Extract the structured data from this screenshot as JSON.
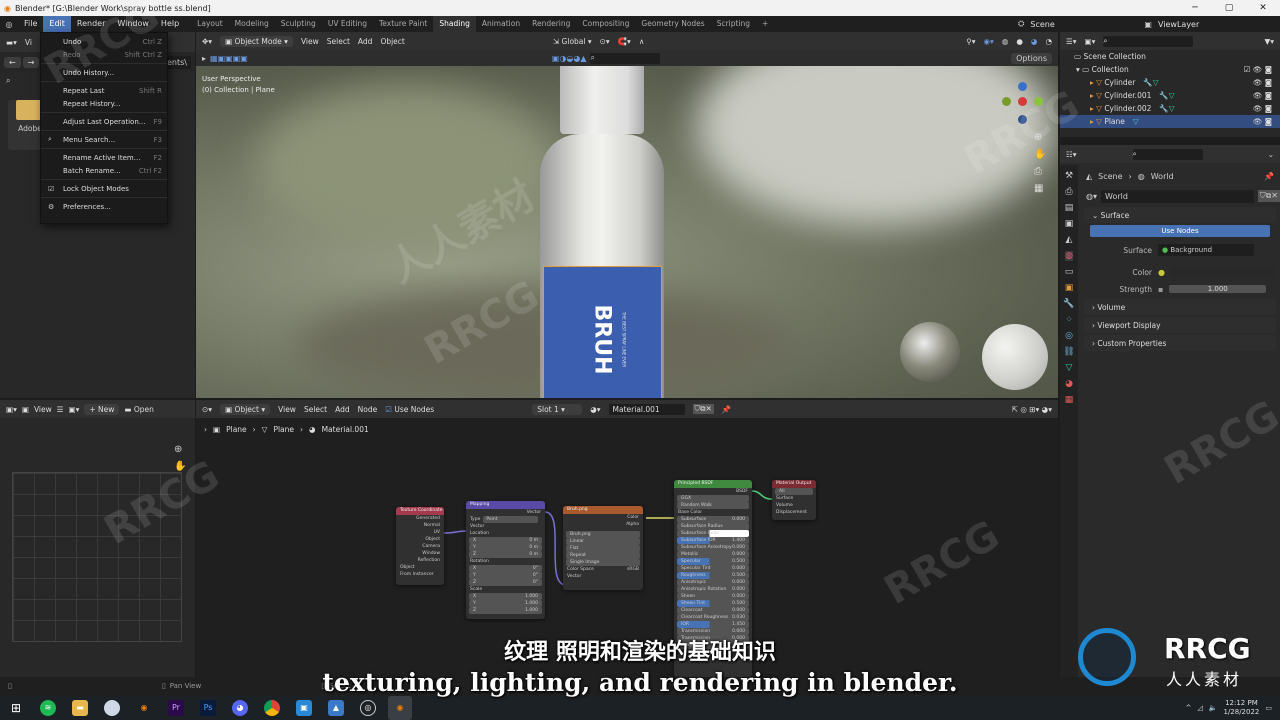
{
  "window": {
    "title": "Blender* [G:\\Blender Work\\spray bottle ss.blend]",
    "controls": [
      "─",
      "▢",
      "✕"
    ]
  },
  "menubar": {
    "items": [
      "File",
      "Edit",
      "Render",
      "Window",
      "Help"
    ],
    "workspaces": [
      "Layout",
      "Modeling",
      "Sculpting",
      "UV Editing",
      "Texture Paint",
      "Shading",
      "Animation",
      "Rendering",
      "Compositing",
      "Geometry Nodes",
      "Scripting",
      "+"
    ],
    "active_workspace": "Shading",
    "scene": "Scene",
    "view_layer": "ViewLayer"
  },
  "edit_menu": {
    "items": [
      {
        "label": "Undo",
        "shortcut": "Ctrl Z"
      },
      {
        "label": "Redo",
        "shortcut": "Shift Ctrl Z",
        "disabled": true
      },
      {
        "label": "Undo History..."
      },
      {
        "label": "Repeat Last",
        "shortcut": "Shift R"
      },
      {
        "label": "Repeat History..."
      },
      {
        "label": "Adjust Last Operation...",
        "shortcut": "F9"
      },
      {
        "label": "Menu Search...",
        "shortcut": "F3"
      },
      {
        "label": "Rename Active Item...",
        "shortcut": "F2"
      },
      {
        "label": "Batch Rename...",
        "shortcut": "Ctrl F2"
      },
      {
        "label": "Lock Object Modes",
        "checked": true
      },
      {
        "label": "Preferences..."
      }
    ]
  },
  "file_browser": {
    "view_label": "Vi",
    "path_fragment": "ents\\",
    "folder": "Adobe"
  },
  "viewport": {
    "mode": "Object Mode",
    "menus": [
      "View",
      "Select",
      "Add",
      "Object"
    ],
    "orientation": "Global",
    "options": "Options",
    "overlay_line1": "User Perspective",
    "overlay_line2": "(0) Collection | Plane",
    "label_text": "BRUH",
    "label_sub": "THE BEST SPRAY LINE EVER"
  },
  "outliner": {
    "root": "Scene Collection",
    "collection": "Collection",
    "items": [
      {
        "name": "Cylinder",
        "selected": false
      },
      {
        "name": "Cylinder.001",
        "selected": false
      },
      {
        "name": "Cylinder.002",
        "selected": false
      },
      {
        "name": "Plane",
        "selected": true
      }
    ]
  },
  "properties": {
    "breadcrumb": [
      "Scene",
      "World"
    ],
    "world_name": "World",
    "surface_section": "Surface",
    "use_nodes": "Use Nodes",
    "surface_label": "Surface",
    "surface_value": "Background",
    "color_label": "Color",
    "strength_label": "Strength",
    "strength_value": "1.000",
    "sections": [
      "Volume",
      "Viewport Display",
      "Custom Properties"
    ]
  },
  "image_editor": {
    "view": "View",
    "new": "New",
    "open": "Open"
  },
  "node_editor": {
    "mode": "Object",
    "menus": [
      "View",
      "Select",
      "Add",
      "Node"
    ],
    "use_nodes": "Use Nodes",
    "slot": "Slot 1",
    "material": "Material.001",
    "breadcrumb": [
      "Plane",
      "Plane",
      "Material.001"
    ],
    "nodes": {
      "texcoord": {
        "title": "Texture Coordinate",
        "outputs": [
          "Generated",
          "Normal",
          "UV",
          "Object",
          "Camera",
          "Window",
          "Reflection"
        ],
        "object": "Object",
        "instancer": "From Instancer"
      },
      "mapping": {
        "title": "Mapping",
        "output": "Vector",
        "type_label": "Type",
        "type": "Point",
        "vector": "Vector",
        "location": "Location",
        "loc": [
          "0 m",
          "0 m",
          "0 m"
        ],
        "rotation": "Rotation",
        "rot": [
          "0°",
          "0°",
          "0°"
        ],
        "scale": "Scale",
        "scl": [
          "1.000",
          "1.000",
          "1.000"
        ],
        "axes": [
          "X",
          "Y",
          "Z"
        ]
      },
      "image": {
        "title": "Bruh.png",
        "outputs": [
          "Color",
          "Alpha"
        ],
        "image": "Bruh.png",
        "interp": "Linear",
        "proj": "Flat",
        "ext": "Repeat",
        "source": "Single Image",
        "cs_label": "Color Space",
        "cs": "sRGB",
        "input": "Vector"
      },
      "bsdf": {
        "title": "Principled BSDF",
        "output": "BSDF",
        "dist": "GGX",
        "sss": "Random Walk",
        "rows": [
          [
            "Base Color",
            ""
          ],
          [
            "Subsurface",
            "0.000"
          ],
          [
            "Subsurface Radius",
            ""
          ],
          [
            "Subsurface Color",
            ""
          ],
          [
            "Subsurface IOR",
            "1.400"
          ],
          [
            "Subsurface Anisotropy",
            "0.000"
          ],
          [
            "Metallic",
            "0.000"
          ],
          [
            "Specular",
            "0.500"
          ],
          [
            "Specular Tint",
            "0.000"
          ],
          [
            "Roughness",
            "0.500"
          ],
          [
            "Anisotropic",
            "0.000"
          ],
          [
            "Anisotropic Rotation",
            "0.000"
          ],
          [
            "Sheen",
            "0.000"
          ],
          [
            "Sheen Tint",
            "0.500"
          ],
          [
            "Clearcoat",
            "0.000"
          ],
          [
            "Clearcoat Roughness",
            "0.030"
          ],
          [
            "IOR",
            "1.450"
          ],
          [
            "Transmission",
            "0.000"
          ],
          [
            "Transmission Roughness",
            "0.000"
          ],
          [
            "Emission",
            ""
          ]
        ]
      },
      "output": {
        "title": "Material Output",
        "target": "All",
        "inputs": [
          "Surface",
          "Volume",
          "Displacement"
        ]
      }
    }
  },
  "status": {
    "left": "Pan View",
    "mid": "Select"
  },
  "subtitles": {
    "zh": "纹理 照明和渲染的基础知识",
    "en": "texturing, lighting, and rendering in blender."
  },
  "watermark": {
    "text": "RRCG",
    "cn": "人人素材"
  },
  "taskbar": {
    "time": "12:12 PM",
    "date": "1/28/2022",
    "apps": [
      "windows",
      "spotify",
      "explorer",
      "finder",
      "blender",
      "premiere",
      "photoshop",
      "discord",
      "chrome",
      "app",
      "photos",
      "obs",
      "blender-active"
    ]
  },
  "colors": {
    "accent": "#4772b3",
    "selected_row": "#334d80",
    "label_blue": "#3b5fae"
  }
}
